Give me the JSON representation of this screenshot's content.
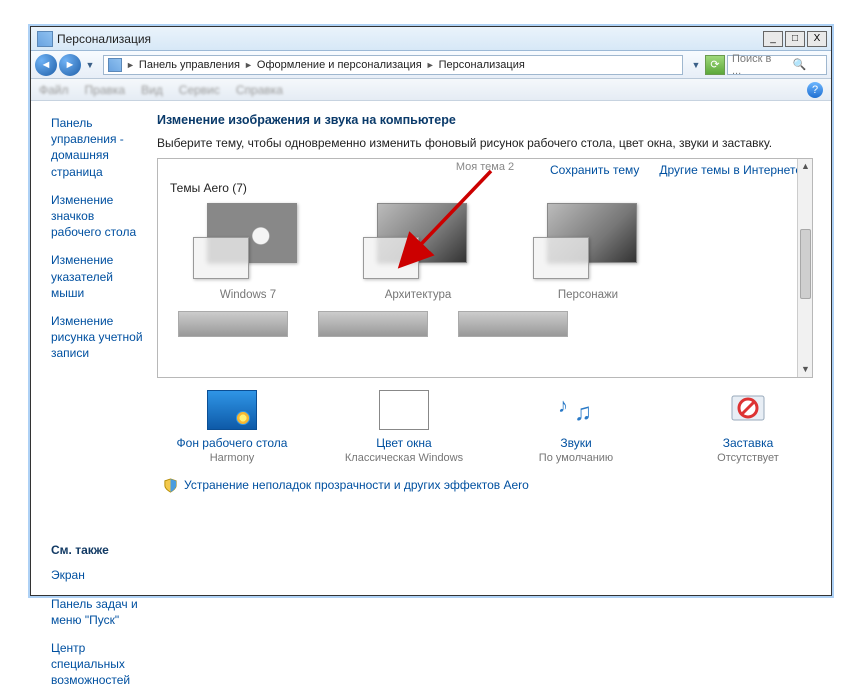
{
  "window": {
    "title": "Персонализация"
  },
  "winbtns": {
    "min": "_",
    "max": "□",
    "close": "X"
  },
  "breadcrumb": {
    "c1": "Панель управления",
    "c2": "Оформление и персонализация",
    "c3": "Персонализация"
  },
  "search": {
    "placeholder": "Поиск в ..."
  },
  "menus": {
    "m1": "Файл",
    "m2": "Правка",
    "m3": "Вид",
    "m4": "Сервис",
    "m5": "Справка"
  },
  "sidebar": {
    "l1": "Панель управления - домашняя страница",
    "l2": "Изменение значков рабочего стола",
    "l3": "Изменение указателей мыши",
    "l4": "Изменение рисунка учетной записи",
    "seeAlso": "См. также",
    "s1": "Экран",
    "s2": "Панель задач и меню \"Пуск\"",
    "s3": "Центр специальных возможностей"
  },
  "main": {
    "heading": "Изменение изображения и звука на компьютере",
    "sub": "Выберите тему, чтобы одновременно изменить фоновый рисунок рабочего стола, цвет окна, звуки и заставку.",
    "mytheme": "Моя тема 2",
    "saveLink": "Сохранить тему",
    "moreLink": "Другие темы в Интернете",
    "sectionHead": "Темы Aero (7)",
    "themes": {
      "t1": "Windows 7",
      "t2": "Архитектура",
      "t3": "Персонажи"
    }
  },
  "bottom": {
    "b1": {
      "title": "Фон рабочего стола",
      "value": "Harmony"
    },
    "b2": {
      "title": "Цвет окна",
      "value": "Классическая Windows"
    },
    "b3": {
      "title": "Звуки",
      "value": "По умолчанию"
    },
    "b4": {
      "title": "Заставка",
      "value": "Отсутствует"
    }
  },
  "troubleshoot": "Устранение неполадок прозрачности и других эффектов Aero"
}
